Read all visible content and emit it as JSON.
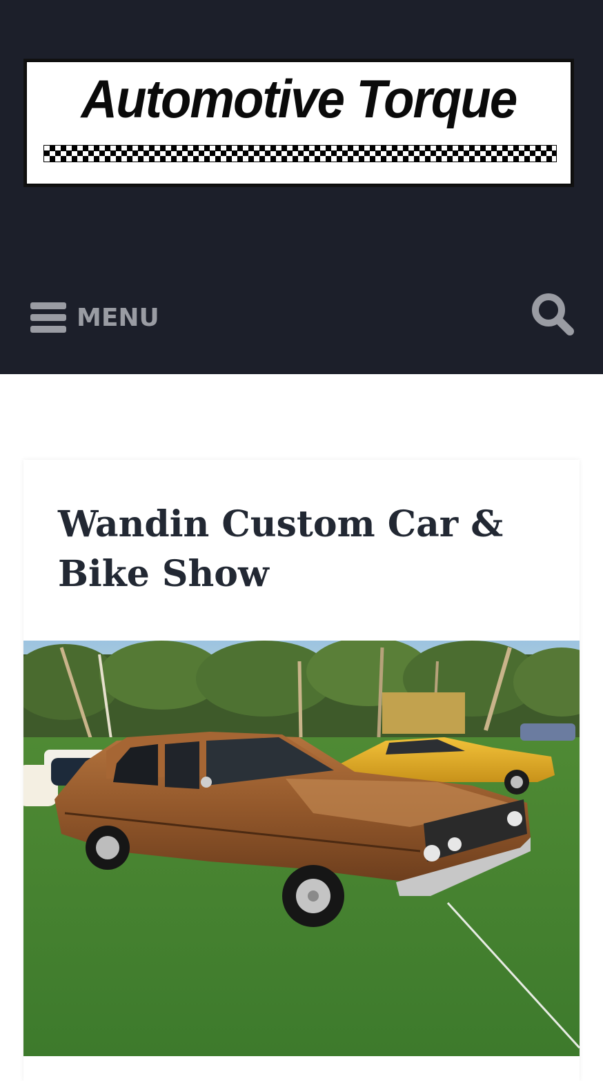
{
  "site": {
    "logo_text": "Automotive Torque",
    "header_bg": "#1c1f2a"
  },
  "nav": {
    "menu_label": "MENU",
    "menu_icon": "hamburger-icon",
    "search_icon": "search-icon",
    "icon_color": "#9a9ca3"
  },
  "post": {
    "title": "Wandin Custom Car & Bike Show",
    "title_color": "#222833",
    "image_subject": "brown vintage sedan at outdoor car show"
  }
}
